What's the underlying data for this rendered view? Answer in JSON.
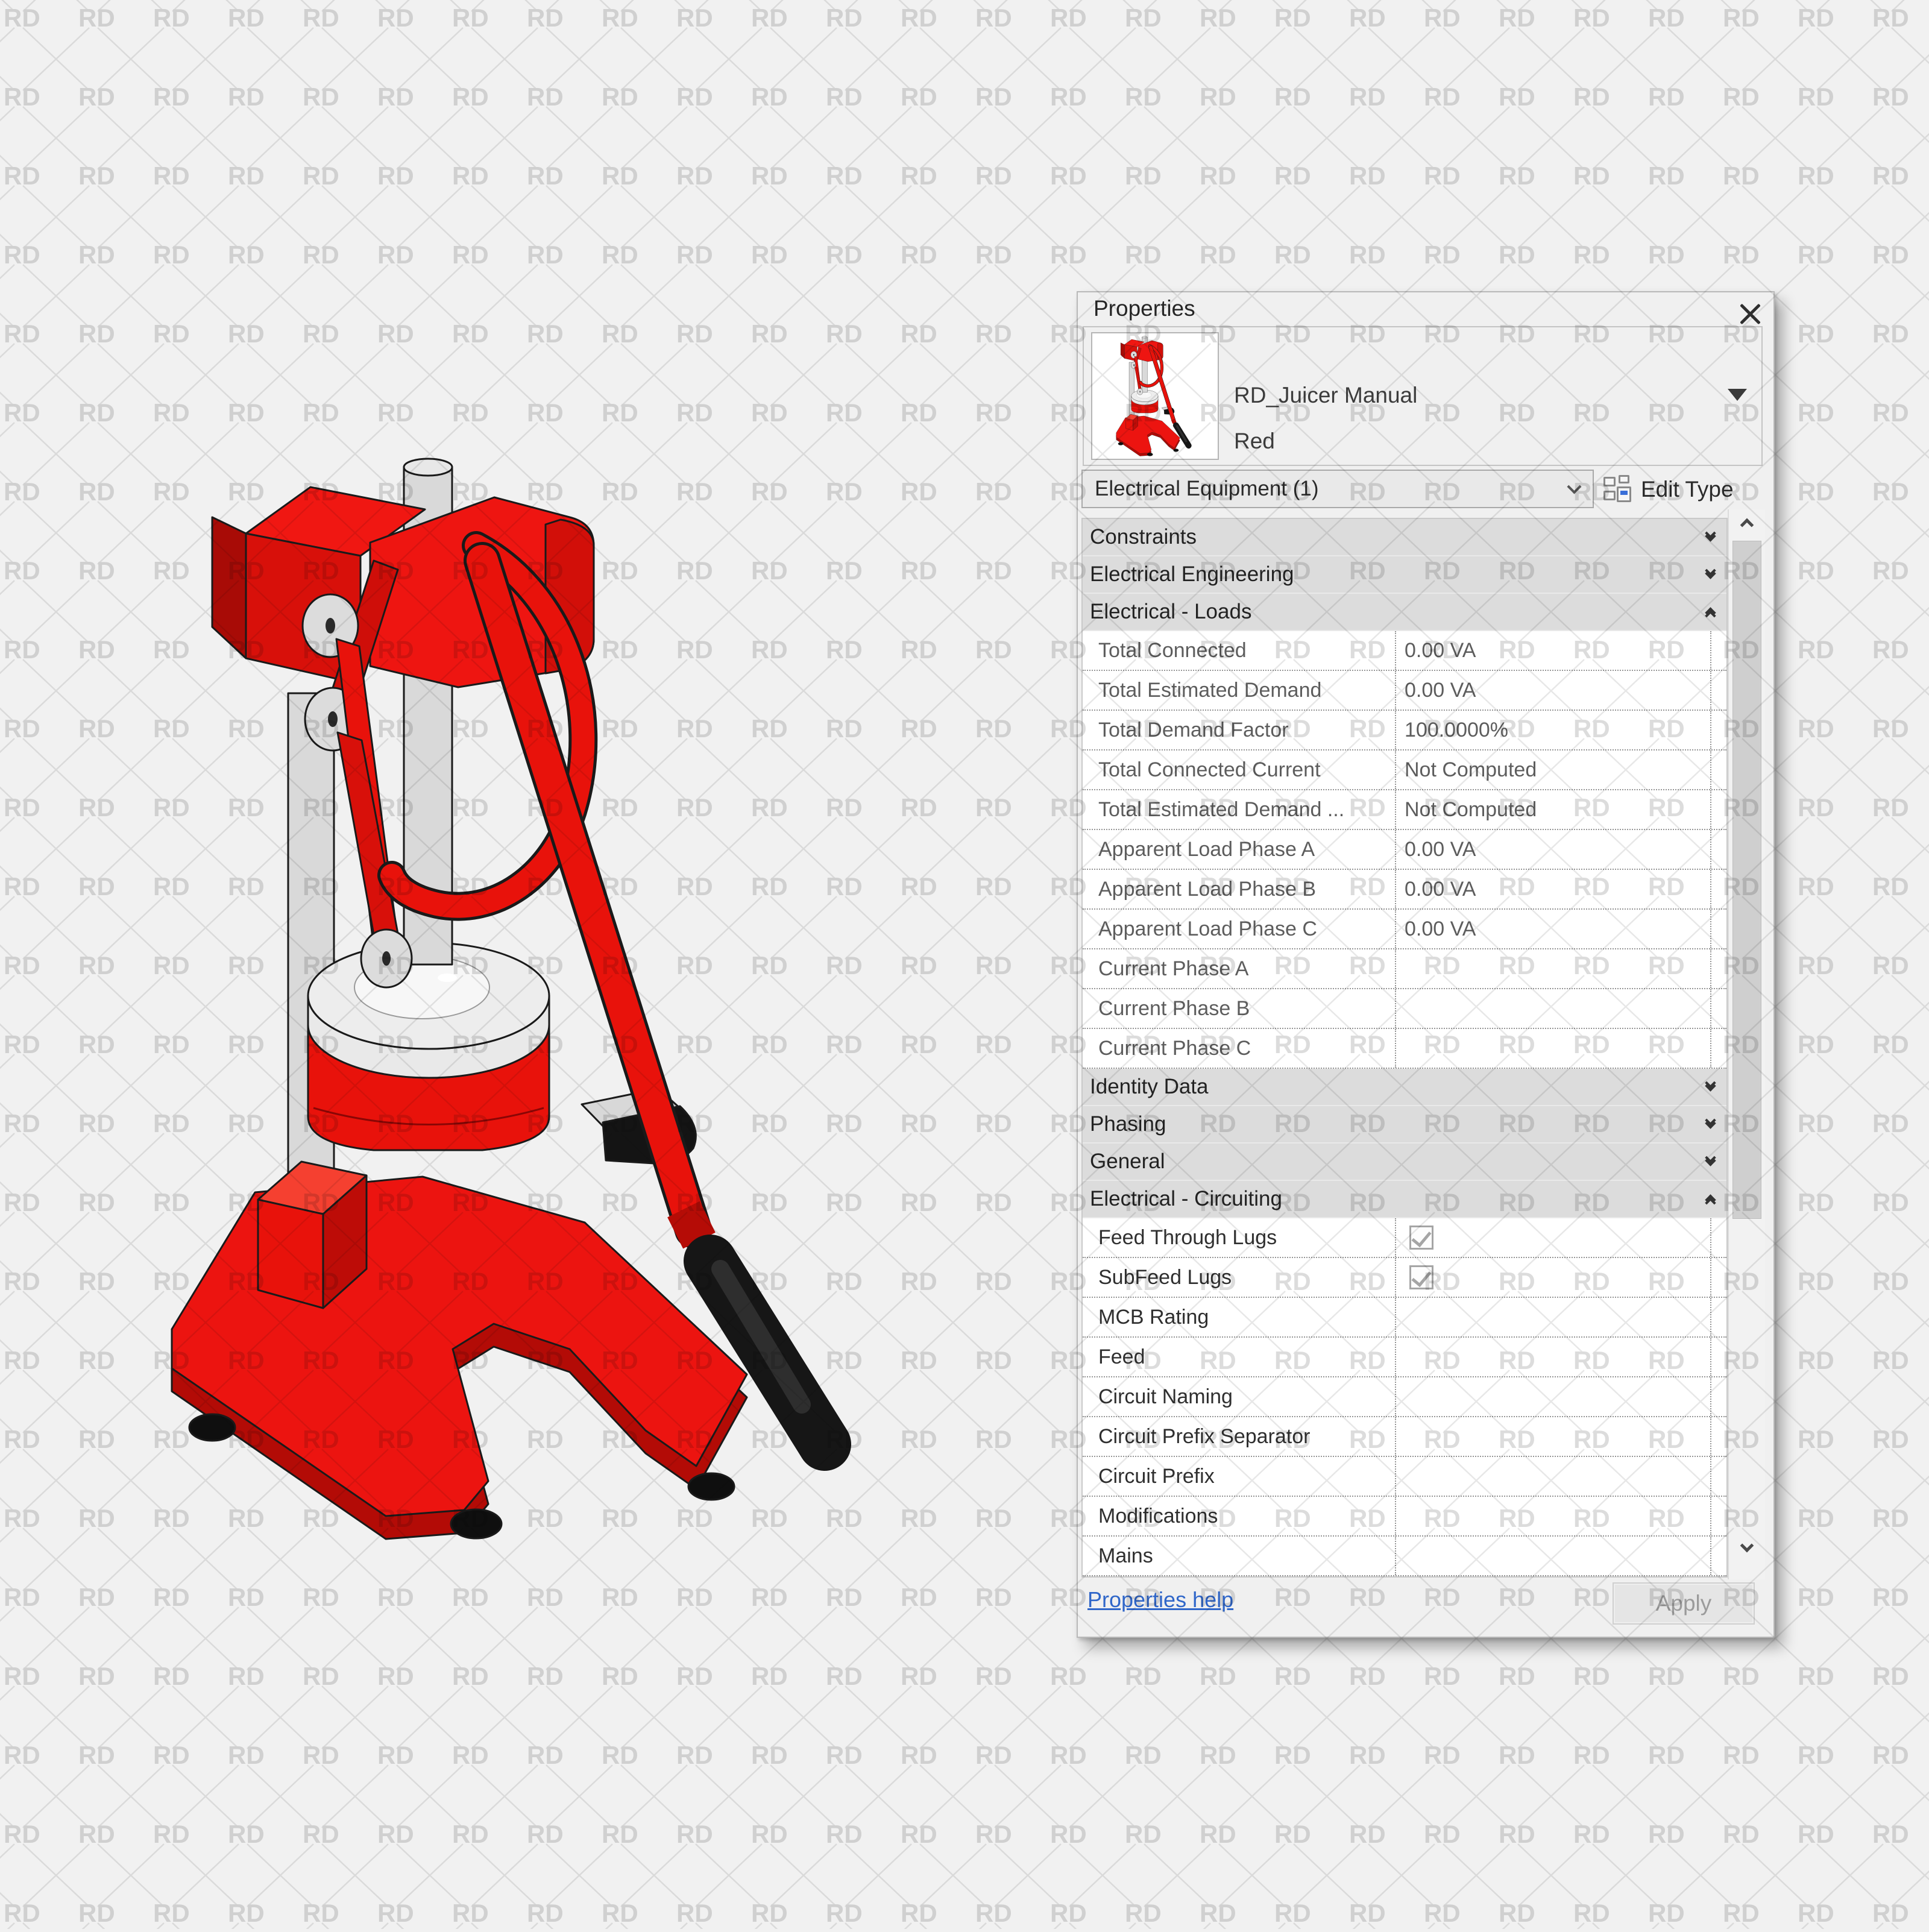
{
  "watermark": {
    "text": "RD"
  },
  "colors": {
    "accent_red": "#ec1410",
    "dark_red": "#b00c06",
    "link_blue": "#2f66c9",
    "panel_bg": "#f0f0f0",
    "header_bg": "#dcdcdc"
  },
  "panel": {
    "title": "Properties",
    "type_selector": {
      "family": "RD_Juicer Manual",
      "type": "Red"
    },
    "filter": {
      "selected": "Electrical Equipment (1)"
    },
    "edit_type_label": "Edit Type",
    "grid": [
      {
        "kind": "header",
        "label": "Constraints",
        "state": "collapsed"
      },
      {
        "kind": "header",
        "label": "Electrical Engineering",
        "state": "collapsed"
      },
      {
        "kind": "header",
        "label": "Electrical - Loads",
        "state": "expanded"
      },
      {
        "kind": "row",
        "label": "Total Connected",
        "value": "0.00 VA",
        "readonly": true
      },
      {
        "kind": "row",
        "label": "Total Estimated Demand",
        "value": "0.00 VA",
        "readonly": true
      },
      {
        "kind": "row",
        "label": "Total Demand Factor",
        "value": "100.0000%",
        "readonly": true
      },
      {
        "kind": "row",
        "label": "Total Connected Current",
        "value": "Not Computed",
        "readonly": true
      },
      {
        "kind": "row",
        "label": "Total Estimated Demand ...",
        "value": "Not Computed",
        "readonly": true
      },
      {
        "kind": "row",
        "label": "Apparent Load Phase A",
        "value": "0.00 VA",
        "readonly": true
      },
      {
        "kind": "row",
        "label": "Apparent Load Phase B",
        "value": "0.00 VA",
        "readonly": true
      },
      {
        "kind": "row",
        "label": "Apparent Load Phase C",
        "value": "0.00 VA",
        "readonly": true
      },
      {
        "kind": "row",
        "label": "Current Phase A",
        "value": "",
        "readonly": true
      },
      {
        "kind": "row",
        "label": "Current Phase B",
        "value": "",
        "readonly": true
      },
      {
        "kind": "row",
        "label": "Current Phase C",
        "value": "",
        "readonly": true
      },
      {
        "kind": "header",
        "label": "Identity Data",
        "state": "collapsed"
      },
      {
        "kind": "header",
        "label": "Phasing",
        "state": "collapsed"
      },
      {
        "kind": "header",
        "label": "General",
        "state": "collapsed"
      },
      {
        "kind": "header",
        "label": "Electrical - Circuiting",
        "state": "expanded"
      },
      {
        "kind": "row",
        "label": "Feed Through Lugs",
        "checkbox": true,
        "checked": true
      },
      {
        "kind": "row",
        "label": "SubFeed Lugs",
        "checkbox": true,
        "checked": true
      },
      {
        "kind": "row",
        "label": "MCB Rating",
        "value": ""
      },
      {
        "kind": "row",
        "label": "Feed",
        "value": ""
      },
      {
        "kind": "row",
        "label": "Circuit Naming",
        "value": ""
      },
      {
        "kind": "row",
        "label": "Circuit Prefix Separator",
        "value": ""
      },
      {
        "kind": "row",
        "label": "Circuit Prefix",
        "value": ""
      },
      {
        "kind": "row",
        "label": "Modifications",
        "value": ""
      },
      {
        "kind": "row",
        "label": "Mains",
        "value": ""
      }
    ],
    "footer": {
      "help": "Properties help",
      "apply": "Apply"
    }
  }
}
